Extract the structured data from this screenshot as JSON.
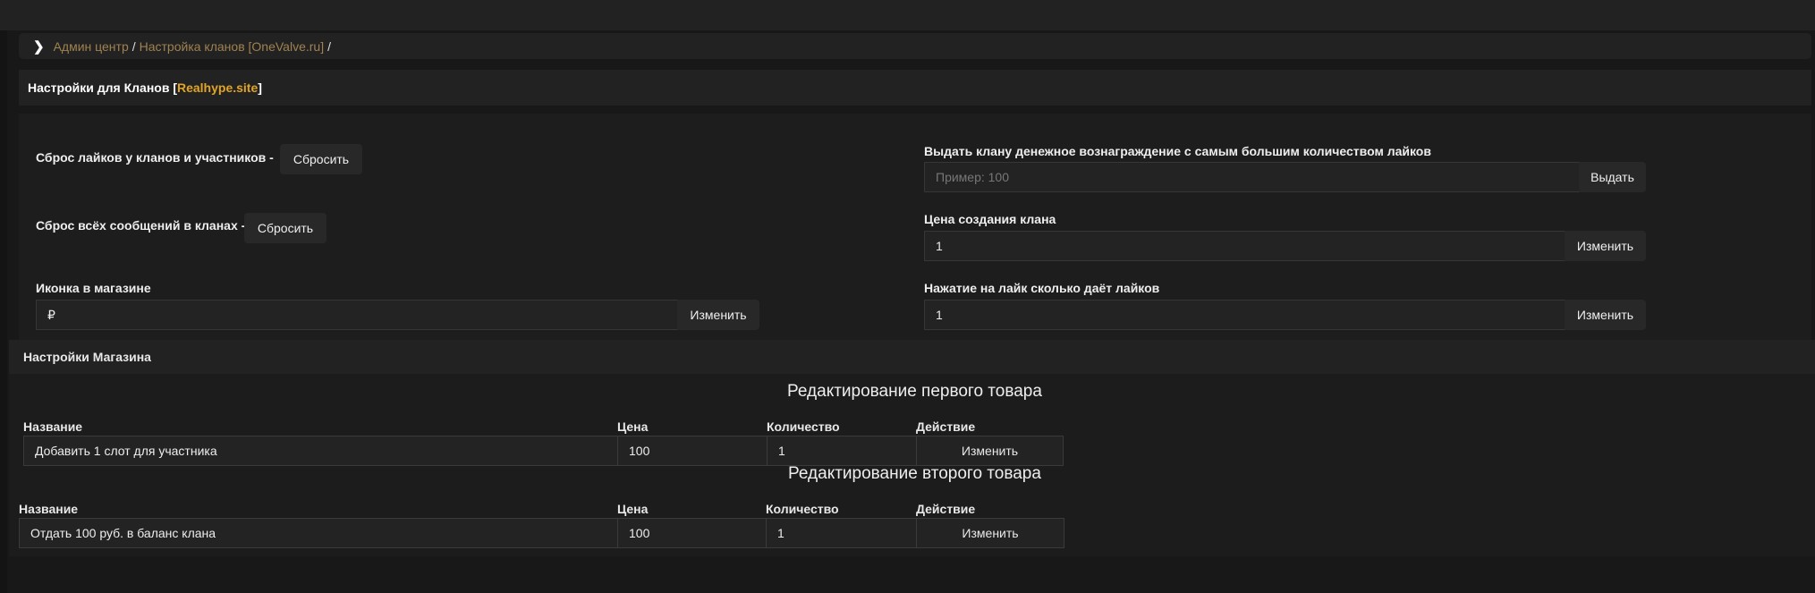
{
  "breadcrumb": {
    "items": [
      "Админ центр",
      "Настройка кланов [OneValve.ru]"
    ],
    "separator": "/"
  },
  "title": {
    "prefix": "Настройки для Кланов [",
    "accent": "Realhype.site",
    "suffix": "]"
  },
  "settings": {
    "reset_likes": {
      "label": "Сброс лайков у кланов и участников -",
      "button": "Сбросить"
    },
    "reset_messages": {
      "label": "Сброс всёх сообщений в кланах -",
      "button": "Сбросить"
    },
    "shop_icon": {
      "label": "Иконка в магазине",
      "value": "₽",
      "button": "Изменить"
    },
    "reward": {
      "label": "Выдать клану денежное вознаграждение с самым большим количеством лайков",
      "placeholder": "Пример: 100",
      "button": "Выдать"
    },
    "clan_price": {
      "label": "Цена создания клана",
      "value": "1",
      "button": "Изменить"
    },
    "like_value": {
      "label": "Нажатие на лайк сколько даёт лайков",
      "value": "1",
      "button": "Изменить"
    }
  },
  "shop": {
    "header": "Настройки Магазина",
    "columns": [
      "Название",
      "Цена",
      "Количество",
      "Действие"
    ],
    "products": [
      {
        "heading": "Редактирование первого товара",
        "name": "Добавить 1 слот для участника",
        "price": "100",
        "quantity": "1",
        "button": "Изменить"
      },
      {
        "heading": "Редактирование второго товара",
        "name": "Отдать 100 руб. в баланс клана",
        "price": "100",
        "quantity": "1",
        "button": "Изменить"
      }
    ]
  },
  "colors": {
    "accent": "#e0a526",
    "link": "#a08250"
  }
}
